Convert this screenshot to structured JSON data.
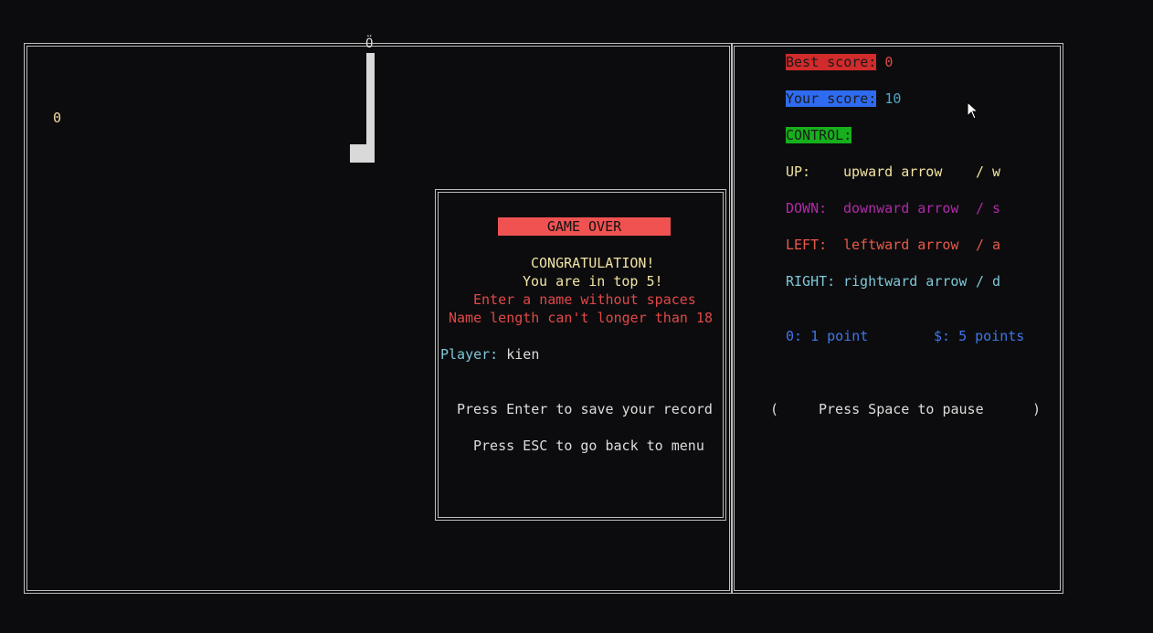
{
  "game": {
    "food_char": "0",
    "snake_head": "Ö"
  },
  "sidebar": {
    "best_score_label": "Best score:",
    "best_score_value": "0",
    "your_score_label": "Your score:",
    "your_score_value": "10",
    "control_label": "CONTROL:",
    "controls": [
      {
        "key": "UP:",
        "action": "upward arrow",
        "alt": "/ w"
      },
      {
        "key": "DOWN:",
        "action": "downward arrow",
        "alt": "/ s"
      },
      {
        "key": "LEFT:",
        "action": "leftward arrow",
        "alt": "/ a"
      },
      {
        "key": "RIGHT:",
        "action": "rightward arrow",
        "alt": "/ d"
      }
    ],
    "points_small": "0: 1 point",
    "points_big": "$: 5 points",
    "pause_open": "(",
    "pause_text": "Press Space to pause",
    "pause_close": ")"
  },
  "dialog": {
    "title": "GAME OVER",
    "congrats": "CONGRATULATION!",
    "top_rank": "You are in top 5!",
    "hint_name": "Enter a name without spaces",
    "hint_length": "Name length can't longer than 18",
    "player_label": "Player:",
    "player_value": "kien",
    "save_hint": "Press Enter to save your record",
    "esc_hint": "Press ESC to go back to menu"
  },
  "colors": {
    "best_score_bg": "#d12b2b",
    "your_score_bg": "#2f6bf0",
    "control_bg": "#16b01c",
    "gameover_bg": "#f05252"
  }
}
